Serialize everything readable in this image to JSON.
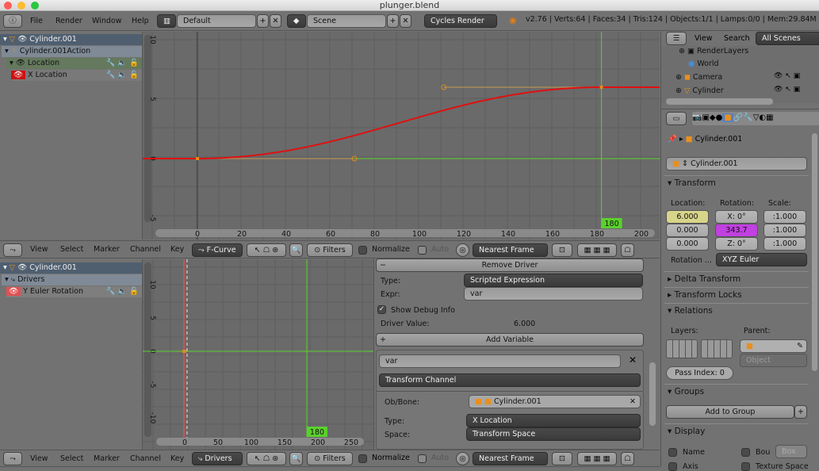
{
  "window": {
    "title": "plunger.blend"
  },
  "info_header": {
    "menus": [
      "File",
      "Render",
      "Window",
      "Help"
    ],
    "layout": "Default",
    "scene": "Scene",
    "engine": "Cycles Render",
    "stats": "v2.76 | Verts:64 | Faces:34 | Tris:124 | Objects:1/1 | Lamps:0/0 | Mem:29.84M | Cylinder"
  },
  "graph_editor": {
    "channels": [
      {
        "label": "Cylinder.001"
      },
      {
        "label": "Cylinder.001Action"
      },
      {
        "label": "Location"
      },
      {
        "label": "X Location"
      }
    ],
    "x_ticks": [
      "0",
      "20",
      "40",
      "60",
      "80",
      "100",
      "120",
      "140",
      "160",
      "180",
      "200"
    ],
    "y_ticks": [
      "10",
      "5",
      "0",
      "-5"
    ],
    "current_frame": "180",
    "curve": {
      "color": "#e01010",
      "keyframes": [
        {
          "frame": 0,
          "value": 0
        },
        {
          "frame": 182,
          "value": 6
        }
      ]
    },
    "header": {
      "menus": [
        "View",
        "Select",
        "Marker",
        "Channel",
        "Key"
      ],
      "mode": "F-Curve",
      "filters": "Filters",
      "normalize": "Normalize",
      "auto": "Auto",
      "snap": "Nearest Frame"
    }
  },
  "drivers_editor": {
    "channels": [
      {
        "label": "Cylinder.001"
      },
      {
        "label": "Drivers"
      },
      {
        "label": "Y Euler Rotation"
      }
    ],
    "x_ticks": [
      "0",
      "50",
      "100",
      "150",
      "200",
      "250"
    ],
    "y_ticks": [
      "10",
      "5",
      "0",
      "-5",
      "-10"
    ],
    "current_frame": "180",
    "panel": {
      "remove_driver": "Remove Driver",
      "type_label": "Type:",
      "type_value": "Scripted Expression",
      "expr_label": "Expr:",
      "expr_value": "var",
      "show_debug": "Show Debug Info",
      "show_debug_checked": true,
      "driver_value_label": "Driver Value:",
      "driver_value": "6.000",
      "add_variable": "Add Variable",
      "var_name": "var",
      "var_type": "Transform Channel",
      "ob_bone_label": "Ob/Bone:",
      "ob_bone_value": "Cylinder.001",
      "channel_type_label": "Type:",
      "channel_type_value": "X Location",
      "space_label": "Space:",
      "space_value": "Transform Space"
    },
    "header": {
      "menus": [
        "View",
        "Select",
        "Marker",
        "Channel",
        "Key"
      ],
      "mode": "Drivers",
      "filters": "Filters",
      "normalize": "Normalize",
      "auto": "Auto",
      "snap": "Nearest Frame"
    }
  },
  "outliner": {
    "menus": [
      "View",
      "Search"
    ],
    "filter": "All Scenes",
    "items": [
      {
        "label": "RenderLayers"
      },
      {
        "label": "World"
      },
      {
        "label": "Camera"
      },
      {
        "label": "Cylinder"
      }
    ]
  },
  "properties": {
    "breadcrumb": "Cylinder.001",
    "object_name": "Cylinder.001",
    "transform": {
      "title": "Transform",
      "location_label": "Location:",
      "rotation_label": "Rotation:",
      "scale_label": "Scale:",
      "location": [
        "6.000",
        "0.000",
        "0.000"
      ],
      "rotation": [
        "X:  0°",
        "343.7",
        "Z:  0°"
      ],
      "scale": [
        ":1.000",
        ":1.000",
        ":1.000"
      ],
      "rotation_mode_label": "Rotation ...",
      "rotation_mode": "XYZ Euler"
    },
    "panels": {
      "delta": "Delta Transform",
      "locks": "Transform Locks",
      "relations": "Relations",
      "groups": "Groups",
      "display": "Display"
    },
    "relations": {
      "layers_label": "Layers:",
      "parent_label": "Parent:",
      "parent_type": "Object",
      "pass_index": "Pass Index:",
      "pass_index_value": "0"
    },
    "groups": {
      "add": "Add to Group"
    },
    "display": {
      "name": "Name",
      "bounds": "Bou",
      "bounds_type": "Box",
      "axis": "Axis",
      "texture_space": "Texture Space"
    }
  },
  "colors": {
    "keyframe_handle": "#e08a1e",
    "current_frame": "#5ad12c",
    "fcurve": "#e01010",
    "driven_highlight": "#c040e0",
    "animated_field": "#d8d48a"
  }
}
